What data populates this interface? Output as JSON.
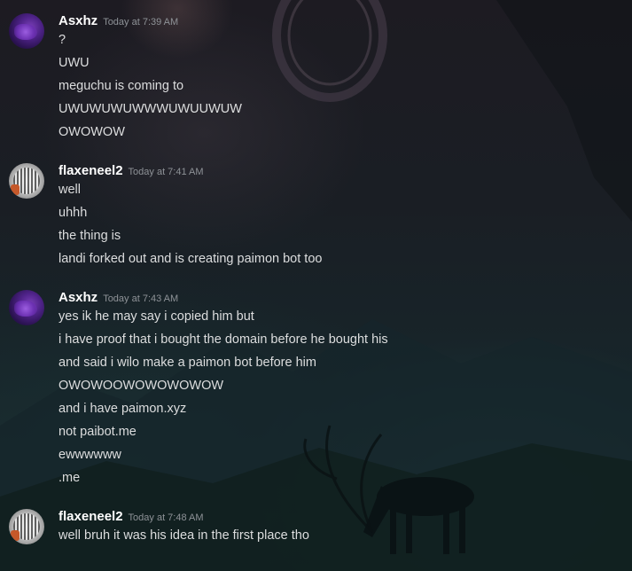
{
  "messages": [
    {
      "author": "Asxhz",
      "timestamp": "Today at 7:39 AM",
      "avatar": "purple-avatar",
      "lines": [
        "?",
        "UWU",
        "meguchu is coming to",
        "UWUWUWUWWWUWUUWUW",
        "OWOWOW"
      ]
    },
    {
      "author": "flaxeneel2",
      "timestamp": "Today at 7:41 AM",
      "avatar": "pixel-avatar",
      "lines": [
        "well",
        "uhhh",
        "the thing is",
        "landi forked out and is creating paimon bot too"
      ]
    },
    {
      "author": "Asxhz",
      "timestamp": "Today at 7:43 AM",
      "avatar": "purple-avatar",
      "lines": [
        "yes ik he may say i copied him but",
        "i have proof that i bought the domain before he bought his",
        "and said i wilo make a paimon bot before him",
        "OWOWOOWOWOWOWOW",
        "and i have paimon.xyz",
        "not paibot.me",
        "ewwwwww",
        ".me"
      ]
    },
    {
      "author": "flaxeneel2",
      "timestamp": "Today at 7:48 AM",
      "avatar": "pixel-avatar",
      "lines": [
        "well bruh it was his idea in the first place tho"
      ]
    }
  ],
  "colors": {
    "username": "#ffffff",
    "timestamp": "#8e9297",
    "message_text": "#dcddde"
  }
}
